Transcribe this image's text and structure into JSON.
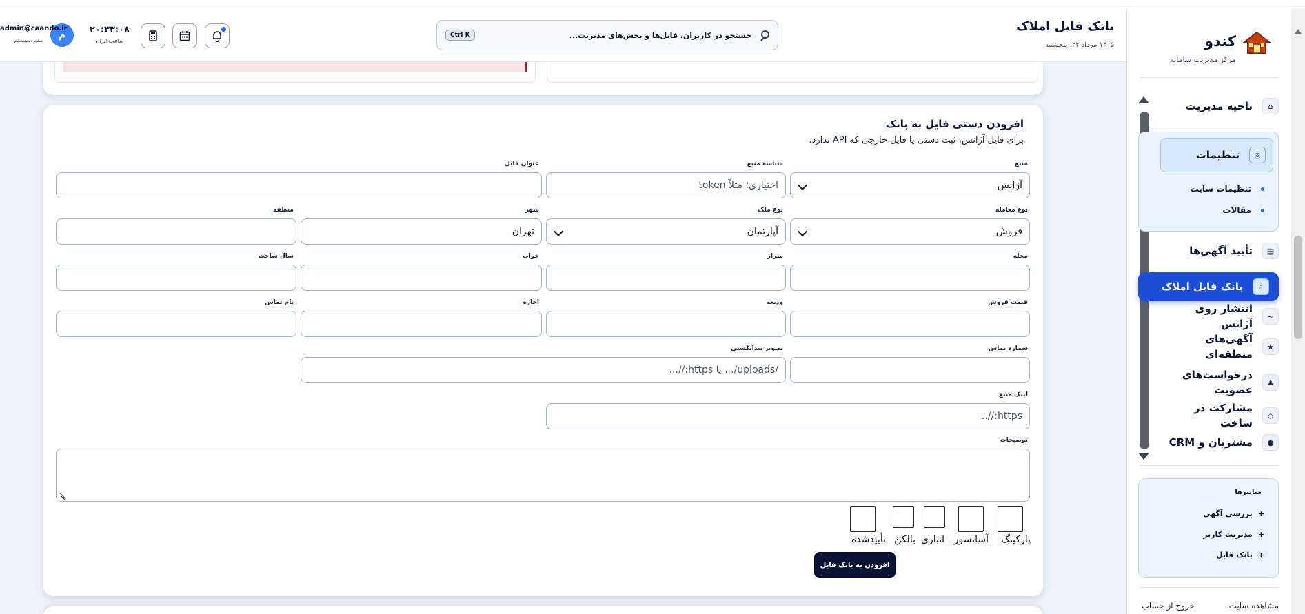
{
  "sidebar": {
    "brand": {
      "title": "کندو",
      "subtitle": "مرکز مدیریت سامانه"
    },
    "nav": {
      "admin_area": "ناحیه مدیریت",
      "settings": {
        "label": "تنظیمات",
        "children": [
          "تنظیمات سایت",
          "مقالات"
        ]
      },
      "approve_ads": "تأیید آگهی‌ها",
      "property_bank": "بانک فایل املاک",
      "publish_agency": "انتشار روی آژانس",
      "regional_ads": "آگهی‌های منطقه‌ای",
      "membership_requests": "درخواست‌های عضویت",
      "construction_partnership": "مشارکت در ساخت",
      "crm": "مشتریان و CRM"
    },
    "shortcuts": {
      "title": "میانبرها",
      "items": [
        "بررسی آگهی",
        "مدیریت کاربر",
        "بانک فایل"
      ]
    },
    "footer": {
      "view_site": "مشاهده سایت",
      "logout": "خروج از حساب"
    }
  },
  "header": {
    "title": "بانک فایل املاک",
    "date": "۱۴۰۵ مرداد ۲۲، پنجشنبه",
    "search": {
      "placeholder": "جستجو در کاربران، فایل‌ها و بخش‌های مدیریت...",
      "shortcut": "Ctrl K"
    },
    "clock": {
      "time": "۲۰:۳۳:۰۸",
      "caption": "ساعت ایران"
    },
    "user": {
      "initial": "م",
      "email": "admin@caando.ir",
      "role": "مدیر سیستم"
    }
  },
  "form": {
    "title": "افزودن دستی فایل به بانک",
    "subtitle": "برای فایل آژانس، ثبت دستی یا فایل خارجی که API ندارد.",
    "labels": {
      "source": "منبع",
      "source_id": "شناسه منبع",
      "file_title": "عنوان فایل",
      "deal_type": "نوع معامله",
      "property_type": "نوع ملک",
      "city": "شهر",
      "region": "منطقه",
      "neighborhood": "محله",
      "area": "متراژ",
      "rooms": "خواب",
      "build_year": "سال ساخت",
      "sale_price": "قیمت فروش",
      "deposit": "ودیعه",
      "rent": "اجاره",
      "contact_name": "نام تماس",
      "contact_phone": "شماره تماس",
      "thumbnail": "تصویر بندانگشتی",
      "source_link": "لینک منبع",
      "description": "توضیحات"
    },
    "values": {
      "source": "آژانس",
      "deal_type": "فروش",
      "property_type": "آپارتمان",
      "city": "تهران"
    },
    "placeholders": {
      "source_id": "اختیاری؛ مثلاً token",
      "thumbnail": "/uploads/... یا https://...",
      "source_link": "https://..."
    },
    "checkboxes": [
      "پارکینگ",
      "آسانسور",
      "انباری",
      "بالکن",
      "تأییدشده"
    ],
    "submit_label": "افزودن به بانک فایل"
  },
  "colors": {
    "primary": "#1d4ed8",
    "navy": "#0b1437",
    "border": "#9db5d4"
  }
}
